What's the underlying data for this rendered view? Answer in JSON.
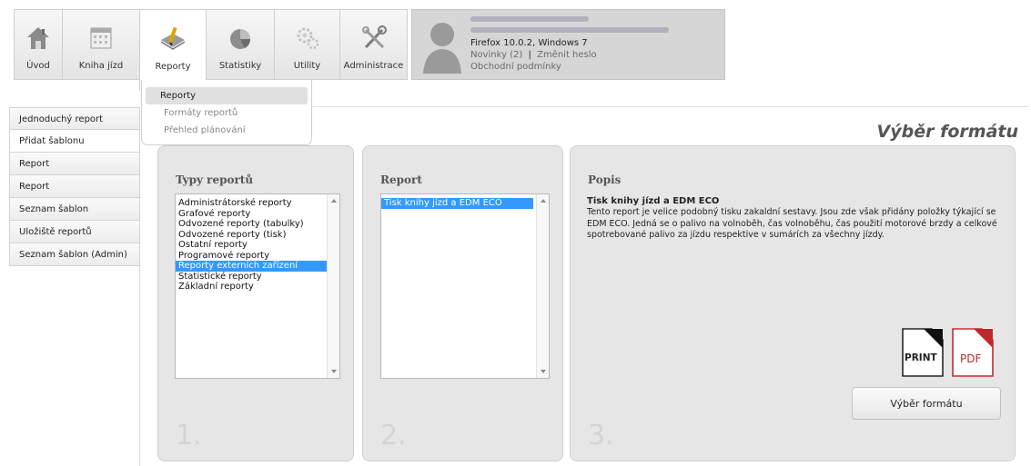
{
  "toolbar": {
    "items": [
      {
        "label": "Úvod",
        "icon": "home-icon"
      },
      {
        "label": "Kniha jízd",
        "icon": "calendar-icon"
      },
      {
        "label": "Reporty",
        "icon": "report-pencil-icon"
      },
      {
        "label": "Statistiky",
        "icon": "pie-chart-icon"
      },
      {
        "label": "Utility",
        "icon": "gears-icon"
      },
      {
        "label": "Administrace",
        "icon": "tools-icon"
      }
    ]
  },
  "user": {
    "browser": "Firefox 10.0.2, Windows 7",
    "news": "Novinky (2)",
    "separator": "|",
    "change_password": "Změnit heslo",
    "terms": "Obchodní podmínky"
  },
  "dropdown": {
    "items": [
      "Reporty",
      "Formáty reportů",
      "Přehled plánování"
    ]
  },
  "sidebar": {
    "items": [
      "Jednoduchý report",
      "Přidat šablonu",
      "Report",
      "Report",
      "Seznam šablon",
      "Uložiště reportů",
      "Seznam šablon (Admin)"
    ]
  },
  "page_title": "Výběr formátu",
  "panels": {
    "types": {
      "title": "Typy reportů",
      "step": "1.",
      "items": [
        "Administrátorské reporty",
        "Grafové reporty",
        "Odvozené reporty (tabulky)",
        "Odvozené reporty (tisk)",
        "Ostatní reporty",
        "Programové reporty",
        "Reporty externích zařízení",
        "Statistické reporty",
        "Základní reporty"
      ],
      "selected": "Reporty externích zařízení"
    },
    "report": {
      "title": "Report",
      "step": "2.",
      "items": [
        "Tisk knihy jízd a EDM ECO"
      ]
    },
    "desc": {
      "title": "Popis",
      "step": "3.",
      "heading": "Tisk knihy jízd a EDM ECO",
      "text": "Tento report je velice podobný tisku zakaldní sestavy. Jsou zde však přidány položky týkající se EDM ECO. Jedná se o palivo na volnoběh, čas volnoběhu, čas použití motorové brzdy a celkové spotrebované palivo za jízdu respektive v sumárích za všechny jízdy.",
      "print_label": "PRINT",
      "pdf_label": "PDF",
      "button_label": "Výběr formátu"
    }
  },
  "colors": {
    "selection": "#3399ff",
    "pdf_red": "#c0282d"
  }
}
